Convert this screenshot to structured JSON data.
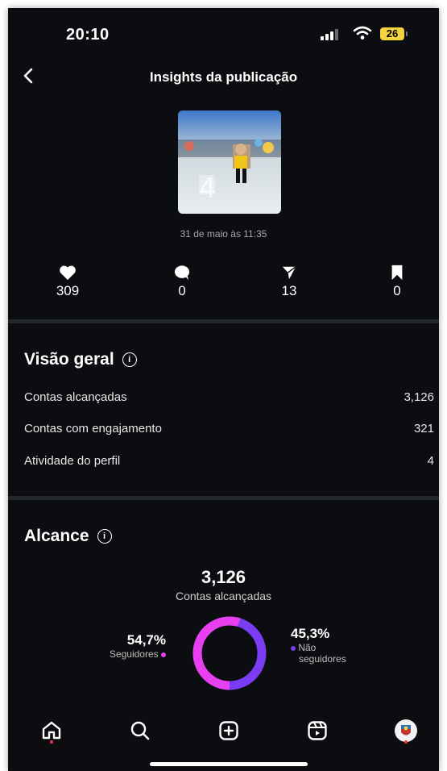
{
  "status": {
    "time": "20:10",
    "battery": "26"
  },
  "header": {
    "title": "Insights da publicação"
  },
  "post": {
    "date": "31 de maio às 11:35"
  },
  "stats": {
    "likes": "309",
    "comments": "0",
    "shares": "13",
    "saves": "0"
  },
  "overview": {
    "title": "Visão geral",
    "rows": [
      {
        "label": "Contas alcançadas",
        "value": "3,126"
      },
      {
        "label": "Contas com engajamento",
        "value": "321"
      },
      {
        "label": "Atividade do perfil",
        "value": "4"
      }
    ]
  },
  "reach": {
    "title": "Alcance",
    "total": "3,126",
    "total_label": "Contas alcançadas",
    "followers_pct": "54,7%",
    "followers_label": "Seguidores",
    "nonfollowers_pct": "45,3%",
    "nonfollowers_label_1": "Não",
    "nonfollowers_label_2": "seguidores",
    "followers_fraction": 0.547,
    "followers_color": "#e83ff0",
    "nonfollowers_color": "#7b3cf5"
  },
  "icons": {
    "back": "chevron-left-icon",
    "info": "info-icon",
    "like": "heart-icon",
    "comment": "comment-icon",
    "share": "send-icon",
    "save": "bookmark-icon",
    "nav": [
      "home-icon",
      "search-icon",
      "create-icon",
      "reels-icon",
      "profile-avatar"
    ]
  }
}
